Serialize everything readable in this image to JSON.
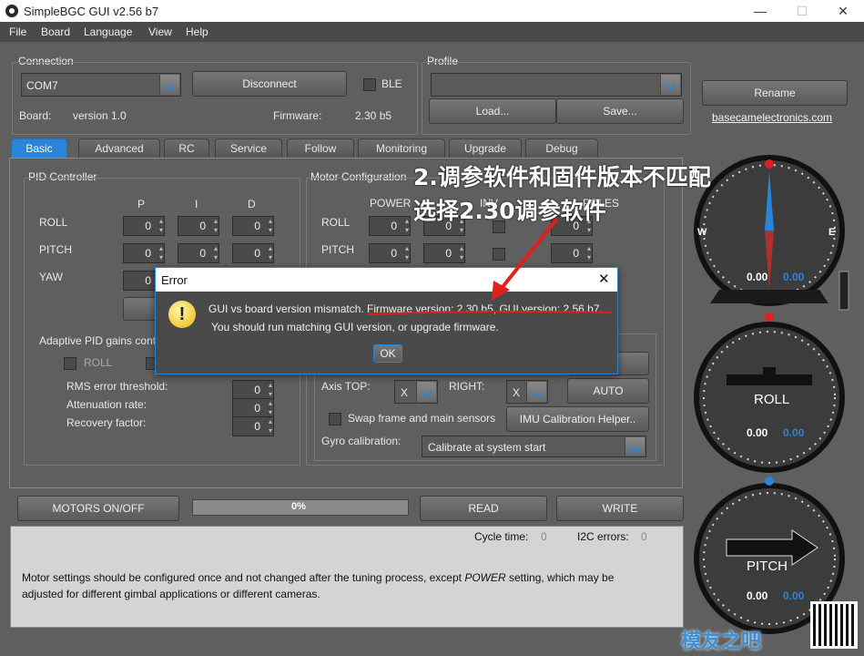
{
  "window": {
    "title": "SimpleBGC GUI v2.56 b7"
  },
  "menu": [
    "File",
    "Board",
    "Language",
    "View",
    "Help"
  ],
  "connection": {
    "label": "Connection",
    "port": "COM7",
    "disconnect": "Disconnect",
    "ble": "BLE",
    "board_label": "Board:",
    "board_value": "version 1.0",
    "firmware_label": "Firmware:",
    "firmware_value": "2.30 b5"
  },
  "profile": {
    "label": "Profile",
    "selected": "",
    "load": "Load...",
    "save": "Save...",
    "rename": "Rename",
    "website": "basecamelectronics.com"
  },
  "tabs": [
    "Basic",
    "Advanced",
    "RC",
    "Service",
    "Follow",
    "Monitoring",
    "Upgrade",
    "Debug"
  ],
  "pid": {
    "label": "PID Controller",
    "cols": [
      "P",
      "I",
      "D"
    ],
    "rows": [
      {
        "name": "ROLL",
        "values": [
          "0",
          "0",
          "0"
        ]
      },
      {
        "name": "PITCH",
        "values": [
          "0",
          "0",
          "0"
        ]
      },
      {
        "name": "YAW",
        "values": [
          "0"
        ]
      }
    ]
  },
  "adaptive": {
    "label": "Adaptive PID gains cont",
    "roll": "ROLL",
    "rms_label": "RMS error threshold:",
    "rms_value": "0",
    "atten_label": "Attenuation rate:",
    "atten_value": "0",
    "recovery_label": "Recovery factor:",
    "recovery_value": "0"
  },
  "motor": {
    "label": "Motor Configuration",
    "cols": [
      "POWER",
      "INV",
      "POLES"
    ],
    "rows": [
      {
        "name": "ROLL",
        "power": "0",
        "v2": "0",
        "poles": "0"
      },
      {
        "name": "PITCH",
        "power": "0",
        "v2": "0",
        "poles": "0"
      }
    ],
    "axis_top_label": "Axis TOP:",
    "axis_top": "X",
    "axis_right_label": "RIGHT:",
    "axis_right": "X",
    "auto": "AUTO",
    "swap_label": "Swap frame and main sensors",
    "imu_helper": "IMU Calibration Helper..",
    "gyro_label": "Gyro calibration:",
    "gyro_value": "Calibrate at system start"
  },
  "bottom": {
    "motors": "MOTORS ON/OFF",
    "progress": "0%",
    "progress_value": 0,
    "read": "READ",
    "write": "WRITE",
    "cycle_label": "Cycle time:",
    "cycle_value": "0",
    "i2c_label": "I2C errors:",
    "i2c_value": "0",
    "help_pre": "Motor settings should be configured once and not changed after the tuning process, except ",
    "help_em": "POWER",
    "help_post": " setting, which may be",
    "help_line2": "adjusted for different gimbal applications or different cameras."
  },
  "dialog": {
    "title": "Error",
    "line1": "GUI vs board version mismatch. Firmware version: 2.30 b5, GUI version: 2.56 b7.",
    "line2": "You should run matching GUI version, or upgrade firmware.",
    "ok": "OK"
  },
  "annotation": {
    "line1": "2.调参软件和固件版本不匹配",
    "line2": "选择2.30调参软件",
    "color": "#e0201c"
  },
  "dials": {
    "compass": {
      "w": "W",
      "e": "E",
      "v1": "0.00",
      "v2": "0.00"
    },
    "roll": {
      "label": "ROLL",
      "v1": "0.00",
      "v2": "0.00"
    },
    "pitch": {
      "label": "PITCH",
      "v1": "0.00",
      "v2": "0.00"
    }
  },
  "watermark": {
    "text": "模友之吧"
  }
}
